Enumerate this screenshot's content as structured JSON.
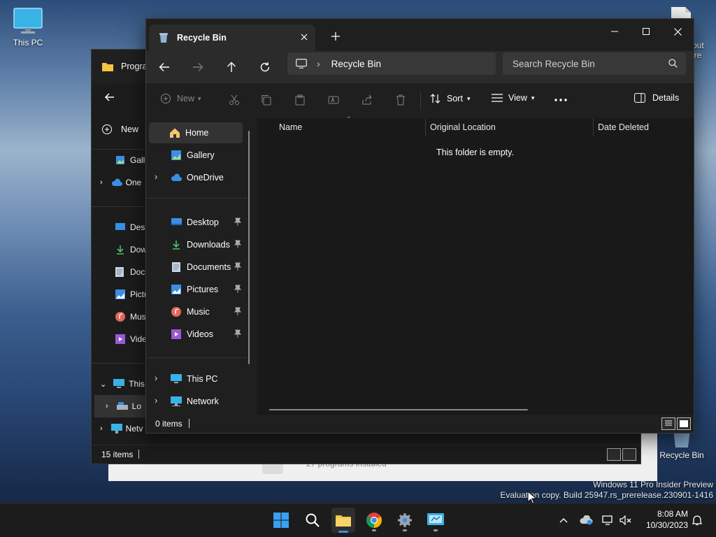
{
  "desktop": {
    "this_pc_label": "This PC",
    "recycle_bin_label": "Recycle Bin",
    "partial_icon_text_1": "out",
    "partial_icon_text_2": "ire",
    "watermark_line1": "Windows 11 Pro Insider Preview",
    "watermark_line2": "Evaluation copy. Build 25947.rs_prerelease.230901-1416"
  },
  "back_window": {
    "tab_title": "Progra",
    "new_label": "New",
    "sidebar_items": [
      "Galle",
      "One",
      "Desk",
      "Dow",
      "Docu",
      "Pictu",
      "Mus",
      "Vide",
      "This",
      "Lo",
      "Netv"
    ],
    "status_text": "15 items",
    "behind_text": "27 programs installed"
  },
  "window": {
    "tab_title": "Recycle Bin",
    "address": "Recycle Bin",
    "search_placeholder": "Search Recycle Bin",
    "toolbar": {
      "new_label": "New",
      "sort_label": "Sort",
      "view_label": "View",
      "details_label": "Details"
    },
    "sidebar": {
      "home": "Home",
      "gallery": "Gallery",
      "onedrive": "OneDrive",
      "pinned": [
        "Desktop",
        "Downloads",
        "Documents",
        "Pictures",
        "Music",
        "Videos"
      ],
      "this_pc": "This PC",
      "network": "Network"
    },
    "columns": [
      "Name",
      "Original Location",
      "Date Deleted"
    ],
    "empty_message": "This folder is empty.",
    "status_text": "0 items"
  },
  "taskbar": {
    "time": "8:08 AM",
    "date": "10/30/2023"
  },
  "colors": {
    "accent_blue": "#3a8ee6",
    "folder_yellow": "#f4c542"
  }
}
